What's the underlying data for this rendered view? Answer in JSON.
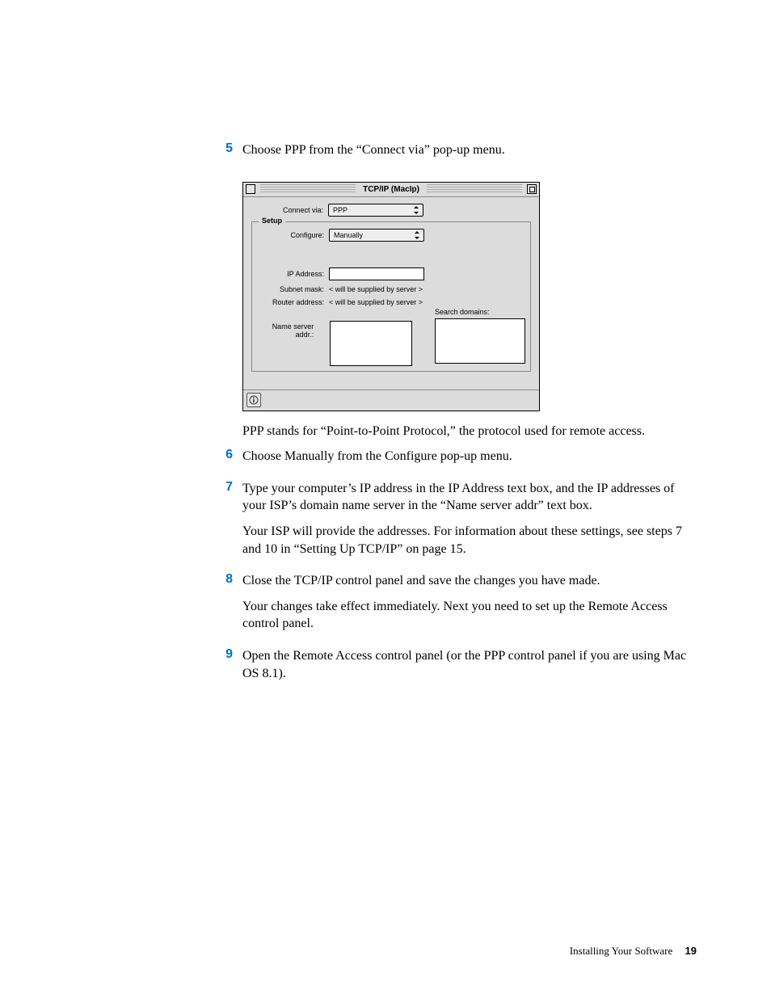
{
  "steps": {
    "s5": {
      "num": "5",
      "text": "Choose PPP from the “Connect via” pop-up menu."
    },
    "s6": {
      "num": "6",
      "text": "Choose Manually from the Configure pop-up menu."
    },
    "s7": {
      "num": "7",
      "text": "Type your computer’s IP address in the IP Address text box, and the IP addresses of your ISP’s domain name server in the “Name server addr” text box.",
      "p2": "Your ISP will provide the addresses. For information about these settings, see steps 7 and 10 in “Setting Up TCP/IP” on page 15."
    },
    "s8": {
      "num": "8",
      "text": "Close the TCP/IP control panel and save the changes you have made.",
      "p2": "Your changes take effect immediately. Next you need to set up the Remote Access control panel."
    },
    "s9": {
      "num": "9",
      "text": "Open the Remote Access control panel (or the PPP control panel if you are using Mac OS 8.1)."
    }
  },
  "after_text": "PPP stands for “Point-to-Point Protocol,” the protocol used for remote access.",
  "window": {
    "title": "TCP/IP (MacIp)",
    "connect_via_label": "Connect via:",
    "connect_via_value": "PPP",
    "setup_legend": "Setup",
    "configure_label": "Configure:",
    "configure_value": "Manually",
    "ip_label": "IP Address:",
    "subnet_label": "Subnet mask:",
    "subnet_value": "< will be supplied by server >",
    "router_label": "Router address:",
    "router_value": "< will be supplied by server >",
    "ns_label": "Name server addr.:",
    "search_label": "Search domains:"
  },
  "footer": {
    "section": "Installing Your Software",
    "page": "19"
  }
}
